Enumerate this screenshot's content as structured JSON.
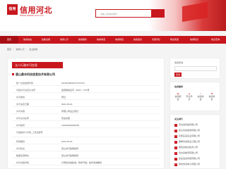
{
  "site": {
    "logo_text": "信用",
    "title": "信用河北",
    "url": "WWW.HEBEI.GOV.CN"
  },
  "search": {
    "placeholder": "请输入查询关键字"
  },
  "nav": [
    {
      "label": "首页"
    },
    {
      "label": "信用动态"
    },
    {
      "label": "政策法规"
    },
    {
      "label": "信用公示"
    },
    {
      "label": "信用服务"
    },
    {
      "label": "信用承诺"
    },
    {
      "label": "信用修复"
    },
    {
      "label": "信用监管"
    },
    {
      "label": "专题专栏"
    },
    {
      "label": "联合奖惩"
    },
    {
      "label": "信用知识"
    },
    {
      "label": "信息查询"
    }
  ],
  "breadcrumb": [
    "首页",
    "信用公示",
    "企业信用"
  ],
  "section": {
    "title": "法人行政许可信息"
  },
  "company": {
    "name": "唐山鼎丰科技信息技术有限公司"
  },
  "rows": [
    {
      "label": "统一社会信用代码",
      "value": "91130200MA07XXXXXX"
    },
    {
      "label": "行政许可决定文书号",
      "value": "冀唐审批企字〔2021〕XXX号"
    },
    {
      "label": "许可类别",
      "value": "登记"
    },
    {
      "label": "许可决定日期",
      "value": "2021-05-20"
    },
    {
      "label": "许可内容",
      "value": "有限公司设立登记"
    },
    {
      "label": "许可证书名称",
      "value": "营业执照"
    },
    {
      "label": "许可编号",
      "value": "130200000000000"
    },
    {
      "label": "行政相对人代码_工商注册号",
      "value": ""
    },
    {
      "label": "有效期自",
      "value": "2021-05-20"
    },
    {
      "label": "许可机关",
      "value": "唐山市行政审批局"
    },
    {
      "label": "数据来源单位",
      "value": "唐山市行政审批局"
    },
    {
      "label": "许可内容详情",
      "value": "计算机系统集成；软件开发；技术咨询服务"
    }
  ],
  "side": {
    "search_title": "信用查询",
    "search_btn": "查询",
    "services_title": "信用服务",
    "services": [
      {
        "icon": "doc-icon",
        "label": "信用报告"
      },
      {
        "icon": "shield-icon",
        "label": "异议申诉"
      },
      {
        "icon": "check-icon",
        "label": "信用承诺"
      },
      {
        "icon": "repair-icon",
        "label": "信用修复"
      }
    ],
    "rank_title": "关注排行",
    "rank": [
      {
        "num": "1",
        "text": "河北某科技有限公司"
      },
      {
        "num": "2",
        "text": "唐山市某贸易有限公司"
      },
      {
        "num": "3",
        "text": "石家庄某实业有限公司"
      },
      {
        "num": "4",
        "text": "邯郸市某建设工程公司"
      },
      {
        "num": "5",
        "text": "保定某信息技术公司"
      },
      {
        "num": "6",
        "text": "沧州某物流有限公司"
      },
      {
        "num": "7",
        "text": "秦皇岛某商贸有限公司"
      },
      {
        "num": "8",
        "text": "廊坊市某电子有限公司"
      }
    ]
  },
  "colors": {
    "brand": "#c8161d"
  }
}
